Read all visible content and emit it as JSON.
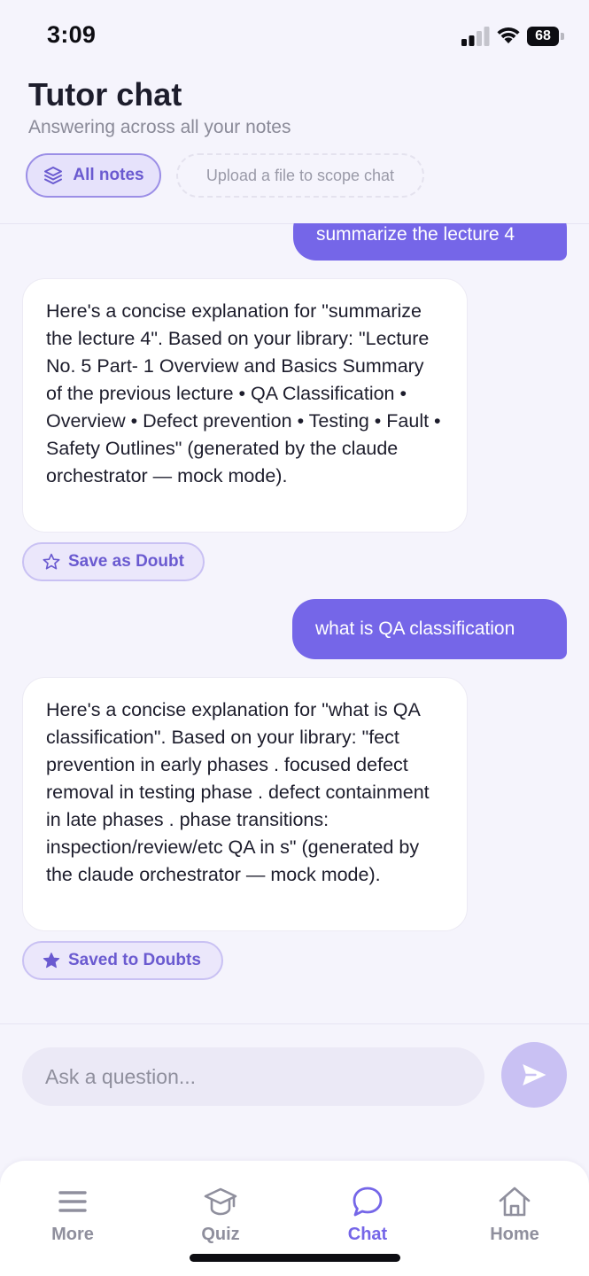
{
  "status_bar": {
    "time": "3:09",
    "battery": "68"
  },
  "header": {
    "title": "Tutor chat",
    "subtitle": "Answering across all your notes",
    "chip_all_label": "All notes",
    "chip_all_icon": "layers-icon",
    "chip_upload_label": "Upload a file to scope chat"
  },
  "messages": [
    {
      "role": "user",
      "text": "summarize the lecture 4"
    },
    {
      "role": "assistant",
      "text": "Here's a concise explanation for \"summarize the lecture 4\". Based on your library: \"Lecture No. 5 Part- 1 Overview and Basics Summary of the previous lecture • QA Classification • Overview • Defect prevention • Testing • Fault • Safety Outlines\" (generated by the claude orchestrator — mock mode).",
      "action_label": "Save as Doubt",
      "action_icon": "star-outline-icon"
    },
    {
      "role": "user",
      "text": "what is QA classification"
    },
    {
      "role": "assistant",
      "text": "Here's a concise explanation for \"what is QA classification\". Based on your library: \"fect prevention in early phases . focused defect removal in testing phase . defect containment in late phases . phase transitions: inspection/review/etc QA in s\" (generated by the claude orchestrator — mock mode).",
      "action_label": "Saved to Doubts",
      "action_icon": "star-filled-icon"
    }
  ],
  "composer": {
    "placeholder": "Ask a question...",
    "send_icon": "send-icon"
  },
  "tab_bar": {
    "tabs": [
      {
        "label": "More",
        "icon": "menu-icon",
        "active": false
      },
      {
        "label": "Quiz",
        "icon": "graduation-cap-icon",
        "active": false
      },
      {
        "label": "Chat",
        "icon": "chat-bubble-icon",
        "active": true
      },
      {
        "label": "Home",
        "icon": "home-icon",
        "active": false
      }
    ]
  },
  "colors": {
    "accent": "#7566e8",
    "accent_light": "#c9c1f3",
    "chip_background": "#ebe7fb",
    "page_background": "#f5f4fc",
    "muted_text": "#8f8f9d"
  }
}
